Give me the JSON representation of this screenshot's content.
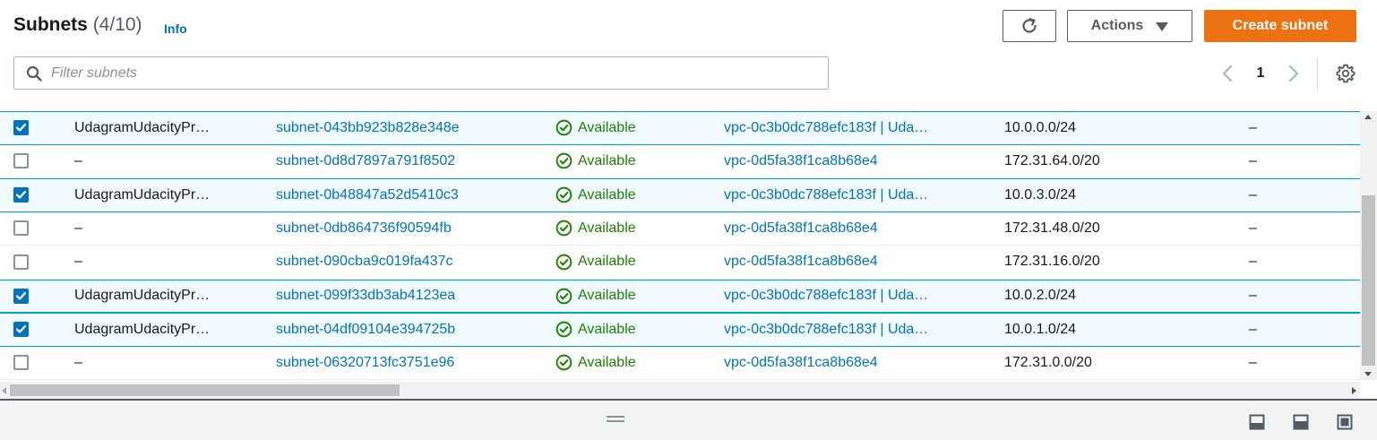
{
  "header": {
    "title": "Subnets",
    "count": "(4/10)",
    "info": "Info",
    "refresh_icon": "refresh-icon",
    "actions_label": "Actions",
    "create_label": "Create subnet",
    "accent_color": "#ec7211",
    "link_color": "#0073bb"
  },
  "search": {
    "placeholder": "Filter subnets",
    "value": ""
  },
  "pagination": {
    "current_page": "1"
  },
  "rows": [
    {
      "selected": true,
      "name": "UdagramUdacityPr…",
      "subnet_id": "subnet-043bb923b828e348e",
      "state": "Available",
      "vpc": "vpc-0c3b0dc788efc183f | Uda…",
      "cidr": "10.0.0.0/24",
      "ipv6": "–"
    },
    {
      "selected": false,
      "name": "–",
      "subnet_id": "subnet-0d8d7897a791f8502",
      "state": "Available",
      "vpc": "vpc-0d5fa38f1ca8b68e4",
      "cidr": "172.31.64.0/20",
      "ipv6": "–"
    },
    {
      "selected": true,
      "name": "UdagramUdacityPr…",
      "subnet_id": "subnet-0b48847a52d5410c3",
      "state": "Available",
      "vpc": "vpc-0c3b0dc788efc183f | Uda…",
      "cidr": "10.0.3.0/24",
      "ipv6": "–"
    },
    {
      "selected": false,
      "name": "–",
      "subnet_id": "subnet-0db864736f90594fb",
      "state": "Available",
      "vpc": "vpc-0d5fa38f1ca8b68e4",
      "cidr": "172.31.48.0/20",
      "ipv6": "–"
    },
    {
      "selected": false,
      "name": "–",
      "subnet_id": "subnet-090cba9c019fa437c",
      "state": "Available",
      "vpc": "vpc-0d5fa38f1ca8b68e4",
      "cidr": "172.31.16.0/20",
      "ipv6": "–"
    },
    {
      "selected": true,
      "name": "UdagramUdacityPr…",
      "subnet_id": "subnet-099f33db3ab4123ea",
      "state": "Available",
      "vpc": "vpc-0c3b0dc788efc183f | Uda…",
      "cidr": "10.0.2.0/24",
      "ipv6": "–"
    },
    {
      "selected": true,
      "name": "UdagramUdacityPr…",
      "subnet_id": "subnet-04df09104e394725b",
      "state": "Available",
      "vpc": "vpc-0c3b0dc788efc183f | Uda…",
      "cidr": "10.0.1.0/24",
      "ipv6": "–"
    },
    {
      "selected": false,
      "name": "–",
      "subnet_id": "subnet-06320713fc3751e96",
      "state": "Available",
      "vpc": "vpc-0d5fa38f1ca8b68e4",
      "cidr": "172.31.0.0/20",
      "ipv6": "–"
    }
  ],
  "colors": {
    "available_green": "#1d8102",
    "selected_row_bg": "#f1faff",
    "selected_border": "#00a1c9",
    "checkbox_checked": "#0073bb"
  },
  "footer": {
    "layout_icons": [
      "split-bottom-icon",
      "split-side-icon",
      "split-full-icon"
    ]
  }
}
